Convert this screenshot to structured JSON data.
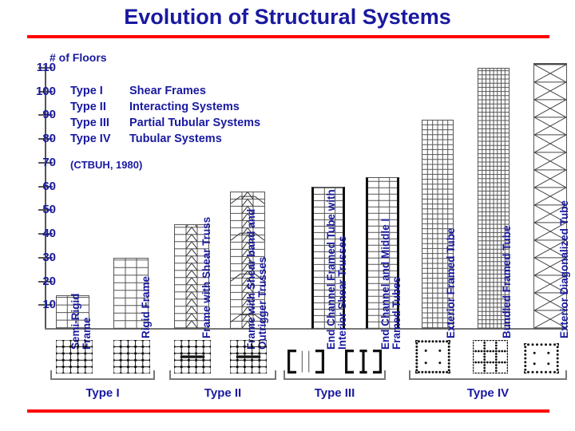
{
  "title": "Evolution of Structural Systems",
  "accent_color": "#1919a0",
  "rule_color": "#fe0000",
  "axis": {
    "title": "# of Floors",
    "ticks": [
      "110",
      "100",
      "90",
      "80",
      "70",
      "60",
      "50",
      "40",
      "30",
      "20",
      "10"
    ]
  },
  "legend": {
    "rows": [
      {
        "key": "Type I",
        "value": "Shear Frames"
      },
      {
        "key": "Type II",
        "value": "Interacting Systems"
      },
      {
        "key": "Type III",
        "value": "Partial Tubular Systems"
      },
      {
        "key": "Type IV",
        "value": "Tubular Systems"
      }
    ],
    "source": "(CTBUH, 1980)"
  },
  "groups": [
    {
      "id": "type-1",
      "label": "Type I"
    },
    {
      "id": "type-2",
      "label": "Type II"
    },
    {
      "id": "type-3",
      "label": "Type III"
    },
    {
      "id": "type-4",
      "label": "Type IV"
    }
  ],
  "bars": [
    {
      "label": "Semi-Rigid\nFrame",
      "value": 14,
      "group": "Type I"
    },
    {
      "label": "Rigid Frame",
      "value": 30,
      "group": "Type I"
    },
    {
      "label": "Frame with Shear Truss",
      "value": 44,
      "group": "Type II"
    },
    {
      "label": "Frame with Shear band and\nOutrigger Trusses",
      "value": 58,
      "group": "Type II"
    },
    {
      "label": "End Channel Framed Tube with\nInterior Shear Trusses",
      "value": 60,
      "group": "Type III"
    },
    {
      "label": "End Channel and Middle I\nFramed Tubes",
      "value": 64,
      "group": "Type III"
    },
    {
      "label": "Exterior Framed Tube",
      "value": 88,
      "group": "Type IV"
    },
    {
      "label": "Bundled Framed Tube",
      "value": 110,
      "group": "Type IV"
    },
    {
      "label": "Exterior Diagonalized Tube",
      "value": 112,
      "group": "Type IV"
    }
  ],
  "chart_data": {
    "type": "bar",
    "title": "Evolution of Structural Systems",
    "xlabel": "",
    "ylabel": "# of Floors",
    "ylim": [
      0,
      115
    ],
    "yticks": [
      10,
      20,
      30,
      40,
      50,
      60,
      70,
      80,
      90,
      100,
      110
    ],
    "grid": false,
    "legend_position": "upper-left-text-block",
    "categories": [
      "Semi-Rigid Frame",
      "Rigid Frame",
      "Frame with Shear Truss",
      "Frame with Shear band and Outrigger Trusses",
      "End Channel Framed Tube with Interior Shear Trusses",
      "End Channel and Middle I Framed Tubes",
      "Exterior Framed Tube",
      "Bundled Framed Tube",
      "Exterior Diagonalized Tube"
    ],
    "values": [
      14,
      30,
      44,
      58,
      60,
      64,
      88,
      110,
      112
    ],
    "group_of_category": [
      "Type I",
      "Type I",
      "Type II",
      "Type II",
      "Type III",
      "Type III",
      "Type IV",
      "Type IV",
      "Type IV"
    ],
    "group_legend": {
      "Type I": "Shear Frames",
      "Type II": "Interacting Systems",
      "Type III": "Partial Tubular Systems",
      "Type IV": "Tubular Systems"
    },
    "annotations": [
      "(CTBUH, 1980)"
    ]
  }
}
